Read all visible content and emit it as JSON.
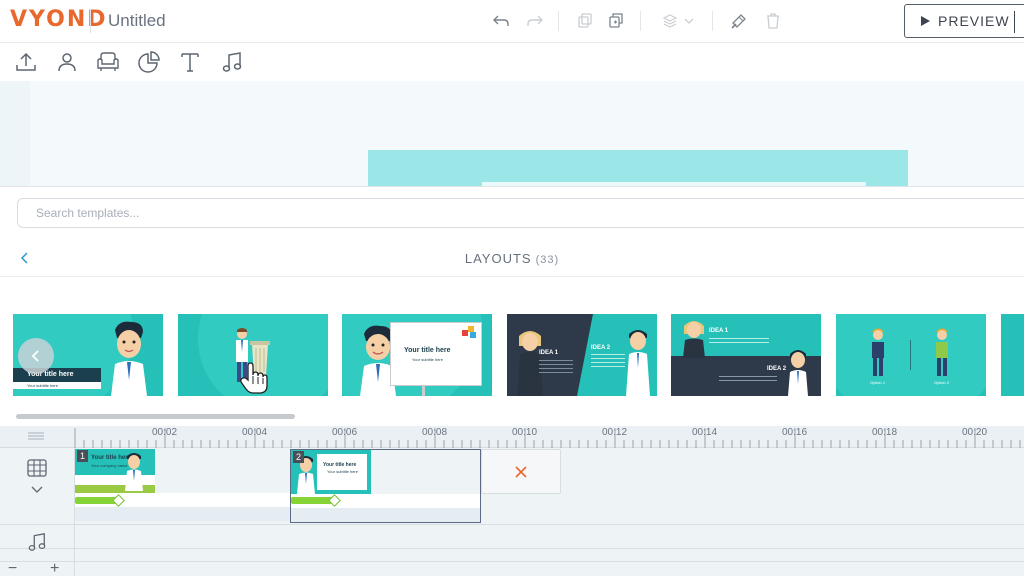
{
  "app": {
    "logo": "VYOND",
    "title": "Untitled"
  },
  "header": {
    "preview_label": "PREVIEW"
  },
  "toolbar": {
    "tools": [
      "upload-icon",
      "character-icon",
      "props-icon",
      "chart-icon",
      "text-icon",
      "music-icon"
    ]
  },
  "templates": {
    "search_placeholder": "Search templates...",
    "section_title": "LAYOUTS",
    "count": "(33)",
    "cards": [
      {
        "title": "Your title here",
        "subtitle": "Your subtitle here"
      },
      {
        "title": "",
        "subtitle": ""
      },
      {
        "title": "Your title here",
        "subtitle": "Your subtitle here"
      },
      {
        "idea1": "IDEA 1",
        "idea2": "IDEA 2"
      },
      {
        "idea1": "IDEA 1",
        "idea2": "IDEA 2"
      },
      {
        "left": "Option 1",
        "right": "Option 2"
      }
    ]
  },
  "timeline": {
    "ticks": [
      "00:02",
      "00:04",
      "00:06",
      "00:08",
      "00:10",
      "00:12",
      "00:14",
      "00:16",
      "00:18",
      "00:20"
    ],
    "scenes": [
      {
        "number": "1",
        "title": "Your title here",
        "subtitle": "Your company name"
      },
      {
        "number": "2",
        "title": "Your title here",
        "subtitle": "Your subtitle here"
      }
    ],
    "zoom_out": "−",
    "zoom_in": "+"
  },
  "colors": {
    "brand": "#e8682d",
    "teal": "#25c1b8",
    "green": "#86d336",
    "delete": "#e8682d"
  }
}
